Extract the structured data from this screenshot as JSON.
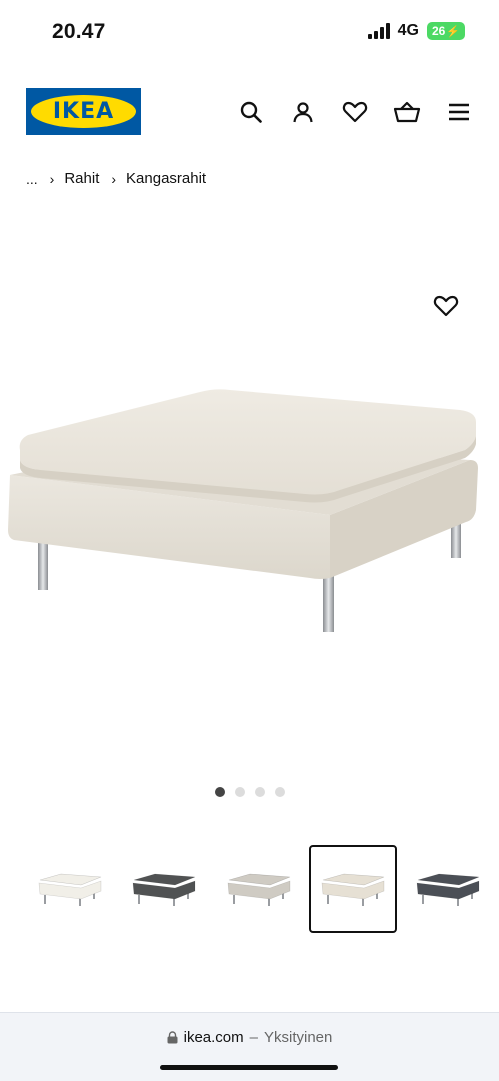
{
  "status_bar": {
    "time": "20.47",
    "network": "4G",
    "battery": "26"
  },
  "header": {
    "logo_text": "IKEA",
    "icons": [
      "search-icon",
      "account-icon",
      "heart-icon",
      "basket-icon",
      "menu-icon"
    ]
  },
  "breadcrumb": {
    "ellipsis": "...",
    "items": [
      "Rahit",
      "Kangasrahit"
    ]
  },
  "gallery": {
    "dots": 4,
    "active_dot": 0,
    "thumbnails": [
      {
        "color": "#f1efe8",
        "selected": false
      },
      {
        "color": "#505253",
        "selected": false
      },
      {
        "color": "#cfcbc3",
        "selected": false
      },
      {
        "color": "#e6e0d4",
        "selected": true
      },
      {
        "color": "#4b4f56",
        "selected": false
      }
    ]
  },
  "browser_bar": {
    "domain": "ikea.com",
    "separator": "–",
    "mode": "Yksityinen"
  },
  "colors": {
    "ikea_blue": "#0058a3",
    "ikea_yellow": "#ffdb00",
    "battery_green": "#4cd964"
  }
}
